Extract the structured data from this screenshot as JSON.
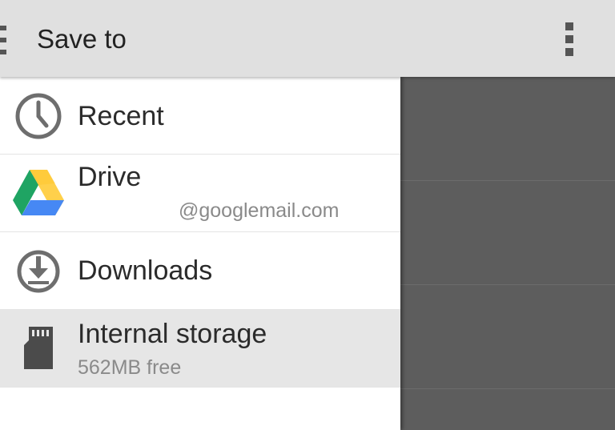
{
  "action_bar": {
    "title": "Save to",
    "menu_icon": "drawer-toggle-icon",
    "overflow_icon": "overflow-menu-icon"
  },
  "drawer": {
    "roots": [
      {
        "title": "Recent",
        "summary": "",
        "icon": "clock-icon",
        "selected": false
      },
      {
        "title": "Drive",
        "summary": "@googlemail.com",
        "icon": "google-drive-icon",
        "selected": false
      },
      {
        "title": "Downloads",
        "summary": "",
        "icon": "download-icon",
        "selected": false
      },
      {
        "title": "Internal storage",
        "summary": "562MB free",
        "icon": "sd-card-icon",
        "selected": true
      }
    ]
  },
  "colors": {
    "action_bar_bg": "#e0e0e0",
    "dim_overlay": "#5d5d5d",
    "selected_bg": "#e6e6e6",
    "drive_green": "#1fa463",
    "drive_yellow": "#ffd04b",
    "drive_blue": "#4688f4"
  }
}
